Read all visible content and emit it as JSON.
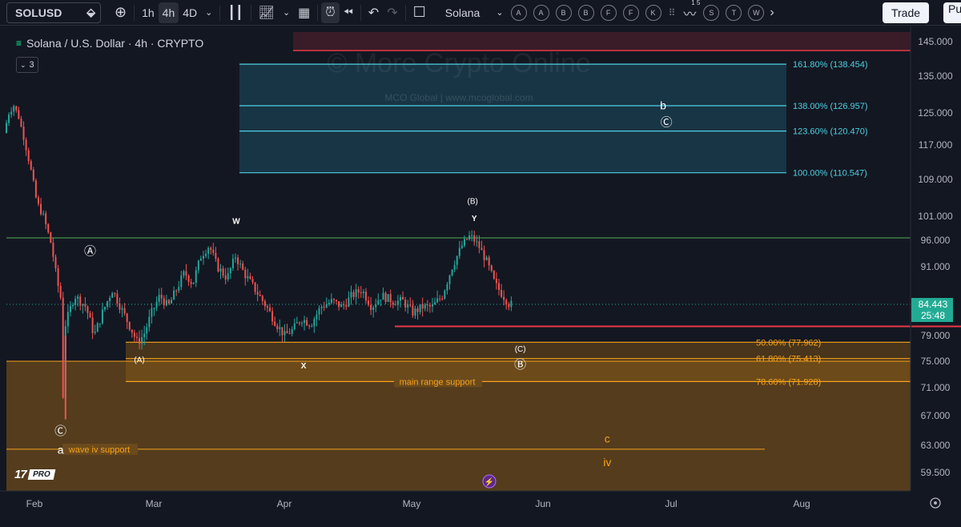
{
  "toolbar": {
    "symbol": "SOLUSD",
    "timeframes": [
      "1h",
      "4h",
      "4D"
    ],
    "active_timeframe": "4h",
    "compare_label": "Solana",
    "circle_buttons": [
      "A",
      "A",
      "B",
      "B",
      "F",
      "F",
      "K"
    ],
    "extra_buttons": [
      "S",
      "T",
      "W"
    ],
    "indicator_badge": "1 5",
    "trade_label": "Trade",
    "publish_label": "Pu"
  },
  "legend": {
    "title": "Solana / U.S. Dollar · 4h · CRYPTO",
    "indicator_count": "3"
  },
  "watermark": {
    "line1": "© More Crypto Online",
    "line2": "MCO Global  |  www.mcoglobal.com"
  },
  "colors": {
    "background": "#131722",
    "up": "#26a69a",
    "down": "#ef5350",
    "fib_blue": "#4dd0e1",
    "fib_orange": "#f7a21b",
    "support_zone": "#6b4a1c",
    "green_line": "#4caf50",
    "red_line": "#e53945",
    "price_label": "#22ab94"
  },
  "chart_data": {
    "type": "candlestick",
    "title": "Solana / U.S. Dollar · 4h · CRYPTO",
    "x_ticks": [
      "Feb",
      "Mar",
      "Apr",
      "May",
      "Jun",
      "Jul",
      "Aug"
    ],
    "y_ticks": [
      "145.000",
      "135.000",
      "125.000",
      "117.000",
      "109.000",
      "101.000",
      "96.000",
      "91.000",
      "79.000",
      "75.000",
      "71.000",
      "67.000",
      "63.000",
      "59.500"
    ],
    "y_tick_values": [
      145,
      135,
      125,
      117,
      109,
      101,
      96,
      91,
      79,
      75,
      71,
      67,
      63,
      59.5
    ],
    "current_price": "84.443",
    "countdown": "25:48",
    "price_path": [
      [
        0,
        120
      ],
      [
        0.3,
        125
      ],
      [
        0.6,
        127
      ],
      [
        0.9,
        124
      ],
      [
        1.2,
        119
      ],
      [
        1.6,
        112
      ],
      [
        2.0,
        104
      ],
      [
        2.4,
        101
      ],
      [
        2.9,
        95
      ],
      [
        3.2,
        89
      ],
      [
        3.5,
        85
      ],
      [
        3.6,
        70
      ],
      [
        3.75,
        81
      ],
      [
        4.3,
        86
      ],
      [
        5.0,
        84
      ],
      [
        5.5,
        79
      ],
      [
        6.0,
        83
      ],
      [
        6.6,
        87
      ],
      [
        7.1,
        84
      ],
      [
        7.6,
        81
      ],
      [
        8.1,
        78
      ],
      [
        8.5,
        79
      ],
      [
        9.0,
        83
      ],
      [
        9.5,
        86
      ],
      [
        10.0,
        84
      ],
      [
        10.5,
        87
      ],
      [
        11.0,
        90
      ],
      [
        11.5,
        88
      ],
      [
        12.0,
        93
      ],
      [
        12.5,
        95
      ],
      [
        13.0,
        91
      ],
      [
        13.6,
        89
      ],
      [
        14.1,
        93
      ],
      [
        14.6,
        90
      ],
      [
        15.3,
        87
      ],
      [
        16.0,
        84
      ],
      [
        16.6,
        81
      ],
      [
        17.1,
        79
      ],
      [
        17.6,
        80
      ],
      [
        18.1,
        82
      ],
      [
        18.7,
        81
      ],
      [
        19.3,
        84
      ],
      [
        20.0,
        85
      ],
      [
        20.6,
        84
      ],
      [
        21.2,
        86
      ],
      [
        21.8,
        87
      ],
      [
        22.4,
        84
      ],
      [
        23.0,
        86
      ],
      [
        23.7,
        85
      ],
      [
        24.3,
        85
      ],
      [
        24.9,
        83
      ],
      [
        25.5,
        84
      ],
      [
        26.1,
        84
      ],
      [
        26.7,
        86
      ],
      [
        27.3,
        91
      ],
      [
        27.9,
        95
      ],
      [
        28.4,
        97
      ],
      [
        28.9,
        95
      ],
      [
        29.4,
        92
      ],
      [
        29.9,
        88
      ],
      [
        30.4,
        86
      ],
      [
        30.8,
        84.4
      ]
    ],
    "fib_levels": [
      {
        "label": "161.80% (138.454)",
        "value": 138.454,
        "group": "upper"
      },
      {
        "label": "138.00% (126.957)",
        "value": 126.957,
        "group": "upper"
      },
      {
        "label": "123.60% (120.470)",
        "value": 120.47,
        "group": "upper"
      },
      {
        "label": "100.00% (110.547)",
        "value": 110.547,
        "group": "upper"
      },
      {
        "label": "50.00% (77.962)",
        "value": 77.962,
        "group": "lower"
      },
      {
        "label": "61.80% (75.413)",
        "value": 75.413,
        "group": "lower"
      },
      {
        "label": "78.60% (71.928)",
        "value": 71.928,
        "group": "lower"
      }
    ],
    "support_labels": {
      "main": "main range support",
      "wave_iv": "wave iv support",
      "wave_iv_value": 62.5
    },
    "horizontal_lines": {
      "green": 96.5,
      "red_short": 80.6,
      "red_top": 142.4,
      "zone_top": 75.0,
      "zone_bottom": 56
    },
    "wave_labels": [
      {
        "text": "W",
        "t": 14.0,
        "price": 99.4
      },
      {
        "text": "Ⓐ",
        "t": 5.1,
        "price": 93.2
      },
      {
        "text": "(B)",
        "t": 28.4,
        "price": 103.7
      },
      {
        "text": "Y",
        "t": 28.5,
        "price": 100.0
      },
      {
        "text": "b",
        "t": 40.0,
        "price": 126.0
      },
      {
        "text": "Ⓒ",
        "t": 40.2,
        "price": 121.7
      },
      {
        "text": "(A)",
        "t": 8.1,
        "price": 74.8
      },
      {
        "text": "X",
        "t": 18.1,
        "price": 73.9
      },
      {
        "text": "(C)",
        "t": 31.3,
        "price": 76.5
      },
      {
        "text": "Ⓑ",
        "t": 31.3,
        "price": 73.9
      },
      {
        "text": "Ⓒ",
        "t": 3.3,
        "price": 64.4
      },
      {
        "text": "a",
        "t": 3.3,
        "price": 61.9
      },
      {
        "text": "c",
        "t": 36.6,
        "price": 63.4
      },
      {
        "text": "iv",
        "t": 36.6,
        "price": 60.3
      }
    ]
  }
}
